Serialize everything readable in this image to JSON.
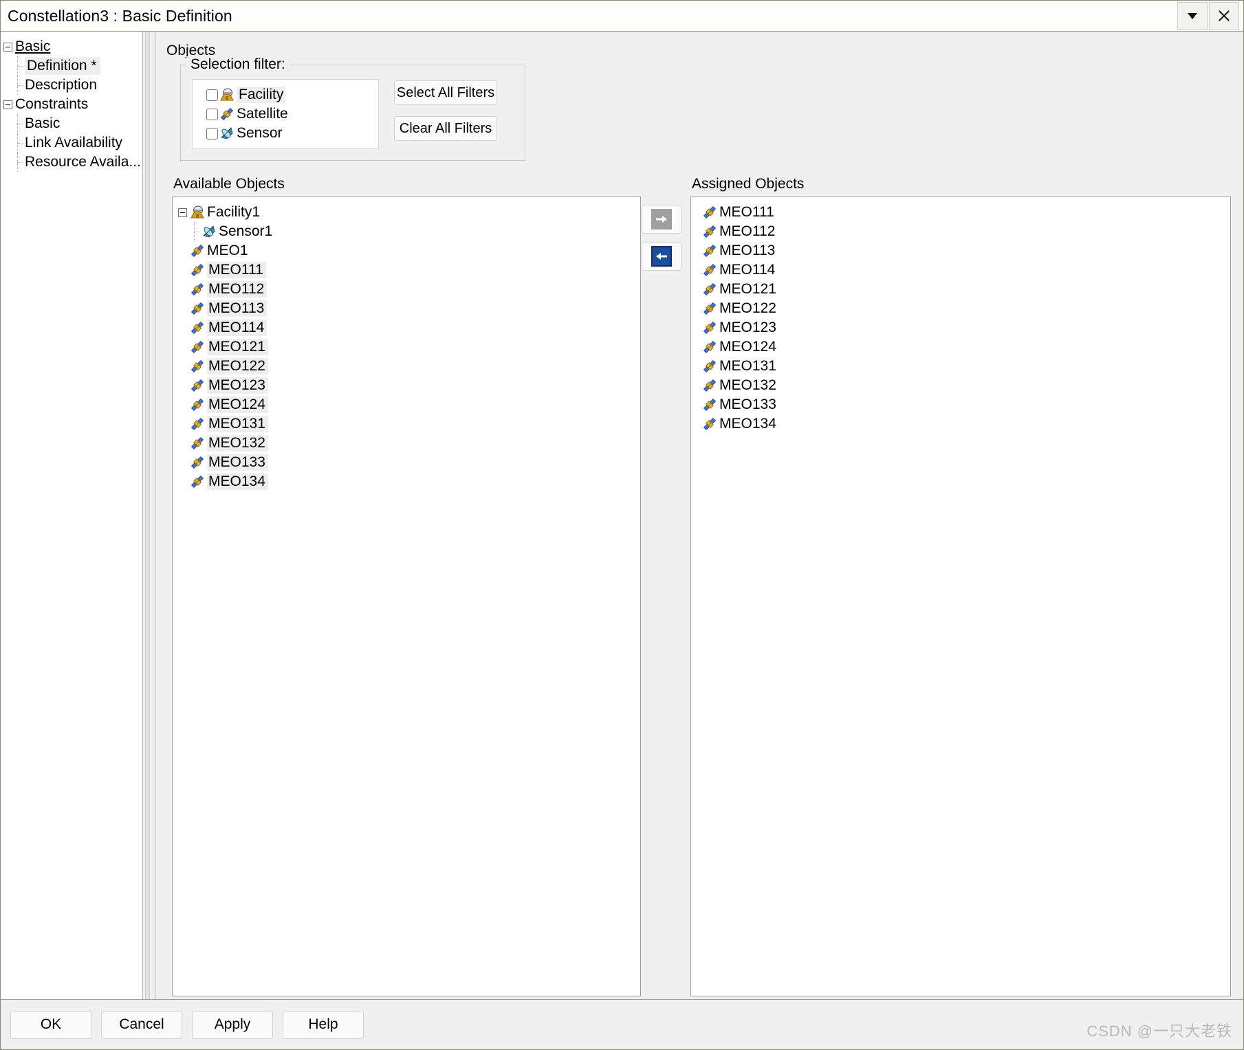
{
  "window": {
    "title": "Constellation3 : Basic Definition",
    "dropdown_icon": "chevron-down-icon",
    "close_icon": "close-icon"
  },
  "sidebar": {
    "items": [
      {
        "label": "Basic",
        "level": 0,
        "expander": true,
        "root": true,
        "selected": false
      },
      {
        "label": "Definition *",
        "level": 1,
        "expander": false,
        "root": false,
        "selected": true
      },
      {
        "label": "Description",
        "level": 1,
        "expander": false,
        "root": false,
        "selected": false
      },
      {
        "label": "Constraints",
        "level": 0,
        "expander": true,
        "root": false,
        "selected": false
      },
      {
        "label": "Basic",
        "level": 1,
        "expander": false,
        "root": false,
        "selected": false
      },
      {
        "label": "Link Availability",
        "level": 1,
        "expander": false,
        "root": false,
        "selected": false
      },
      {
        "label": "Resource Availa...",
        "level": 1,
        "expander": false,
        "root": false,
        "selected": false
      }
    ]
  },
  "main": {
    "objects_label": "Objects",
    "selection_filter": {
      "legend": "Selection filter:",
      "items": [
        {
          "label": "Facility",
          "icon": "facility-icon",
          "checked": false,
          "highlighted": true
        },
        {
          "label": "Satellite",
          "icon": "satellite-icon",
          "checked": false,
          "highlighted": false
        },
        {
          "label": "Sensor",
          "icon": "sensor-icon",
          "checked": false,
          "highlighted": false
        }
      ],
      "select_all_label": "Select All Filters",
      "clear_all_label": "Clear All Filters"
    },
    "available": {
      "caption": "Available Objects",
      "items": [
        {
          "label": "Facility1",
          "icon": "facility-icon",
          "indent": 0,
          "expander": true,
          "selected": false
        },
        {
          "label": "Sensor1",
          "icon": "sensor-icon",
          "indent": 1,
          "expander": false,
          "selected": false
        },
        {
          "label": "MEO1",
          "icon": "satellite-icon",
          "indent": 0,
          "expander": false,
          "selected": false
        },
        {
          "label": "MEO111",
          "icon": "satellite-icon",
          "indent": 0,
          "expander": false,
          "selected": true
        },
        {
          "label": "MEO112",
          "icon": "satellite-icon",
          "indent": 0,
          "expander": false,
          "selected": true
        },
        {
          "label": "MEO113",
          "icon": "satellite-icon",
          "indent": 0,
          "expander": false,
          "selected": true
        },
        {
          "label": "MEO114",
          "icon": "satellite-icon",
          "indent": 0,
          "expander": false,
          "selected": true
        },
        {
          "label": "MEO121",
          "icon": "satellite-icon",
          "indent": 0,
          "expander": false,
          "selected": true
        },
        {
          "label": "MEO122",
          "icon": "satellite-icon",
          "indent": 0,
          "expander": false,
          "selected": true
        },
        {
          "label": "MEO123",
          "icon": "satellite-icon",
          "indent": 0,
          "expander": false,
          "selected": true
        },
        {
          "label": "MEO124",
          "icon": "satellite-icon",
          "indent": 0,
          "expander": false,
          "selected": true
        },
        {
          "label": "MEO131",
          "icon": "satellite-icon",
          "indent": 0,
          "expander": false,
          "selected": true
        },
        {
          "label": "MEO132",
          "icon": "satellite-icon",
          "indent": 0,
          "expander": false,
          "selected": true
        },
        {
          "label": "MEO133",
          "icon": "satellite-icon",
          "indent": 0,
          "expander": false,
          "selected": true
        },
        {
          "label": "MEO134",
          "icon": "satellite-icon",
          "indent": 0,
          "expander": false,
          "selected": true
        }
      ]
    },
    "transfer": {
      "assign_icon": "arrow-right-icon",
      "unassign_icon": "arrow-left-icon",
      "assign_state": "disabled",
      "unassign_state": "enabled"
    },
    "assigned": {
      "caption": "Assigned Objects",
      "items": [
        {
          "label": "MEO111",
          "icon": "satellite-icon"
        },
        {
          "label": "MEO112",
          "icon": "satellite-icon"
        },
        {
          "label": "MEO113",
          "icon": "satellite-icon"
        },
        {
          "label": "MEO114",
          "icon": "satellite-icon"
        },
        {
          "label": "MEO121",
          "icon": "satellite-icon"
        },
        {
          "label": "MEO122",
          "icon": "satellite-icon"
        },
        {
          "label": "MEO123",
          "icon": "satellite-icon"
        },
        {
          "label": "MEO124",
          "icon": "satellite-icon"
        },
        {
          "label": "MEO131",
          "icon": "satellite-icon"
        },
        {
          "label": "MEO132",
          "icon": "satellite-icon"
        },
        {
          "label": "MEO133",
          "icon": "satellite-icon"
        },
        {
          "label": "MEO134",
          "icon": "satellite-icon"
        }
      ]
    }
  },
  "footer": {
    "buttons": [
      "OK",
      "Cancel",
      "Apply",
      "Help"
    ],
    "watermark": "CSDN @一只大老铁"
  },
  "colors": {
    "dialog_bg": "#f0f0f0",
    "list_bg": "#ffffff",
    "selection_bg": "#eeeeee",
    "arrow_enabled": "#1a4f9c",
    "arrow_disabled": "#9f9f9f",
    "satellite_gold": "#d9a420",
    "satellite_blue": "#4a6fc4",
    "sensor_teal": "#3a8fa8"
  }
}
